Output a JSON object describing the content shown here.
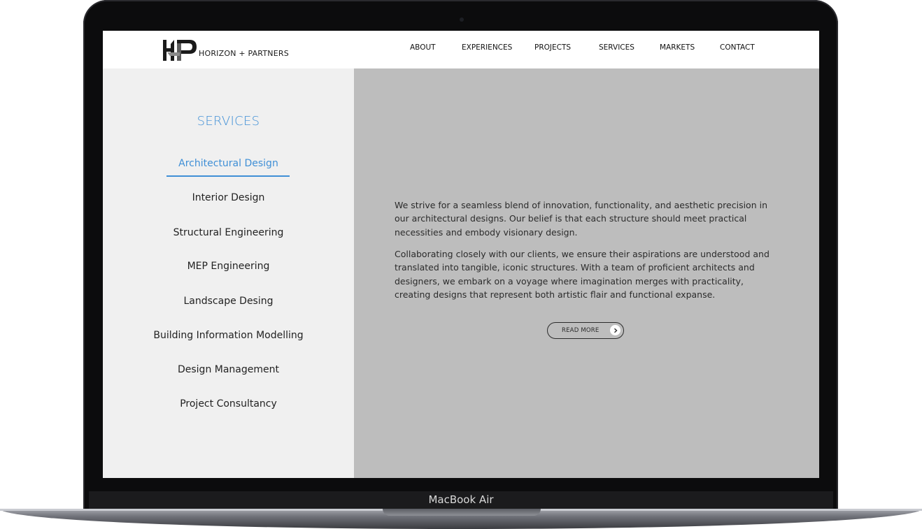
{
  "device": {
    "label": "MacBook Air"
  },
  "brand": {
    "logo_text": "HORIZON + PARTNERS",
    "logo_icon": "hp-monogram-icon"
  },
  "nav": {
    "items": [
      "ABOUT",
      "EXPERIENCES",
      "PROJECTS",
      "SERVICES",
      "MARKETS",
      "CONTACT"
    ]
  },
  "sidebar": {
    "title": "SERVICES",
    "items": [
      {
        "label": "Architectural Design",
        "active": true
      },
      {
        "label": "Interior Design",
        "active": false
      },
      {
        "label": "Structural Engineering",
        "active": false
      },
      {
        "label": "MEP Engineering",
        "active": false
      },
      {
        "label": "Landscape Desing",
        "active": false
      },
      {
        "label": "Building Information Modelling",
        "active": false
      },
      {
        "label": "Design Management",
        "active": false
      },
      {
        "label": "Project Consultancy",
        "active": false
      }
    ]
  },
  "content": {
    "paragraphs": [
      "We strive for a seamless blend of innovation, functionality, and aesthetic precision in our architectural designs. Our belief is that each structure should meet practical necessities and embody visionary design.",
      "Collaborating closely with our clients, we ensure their aspirations are understood and translated into tangible, iconic structures. With a team of proficient architects and designers, we embark on a voyage where imagination merges with practicality, creating designs that represent both artistic flair and functional expanse."
    ],
    "read_more_label": "READ MORE",
    "read_more_icon": "chevron-right-icon"
  },
  "colors": {
    "accent": "#3f8fd6",
    "sidebar_bg": "#f0f0f0",
    "content_bg": "#bdbdbd",
    "text": "#2b2b2b"
  }
}
